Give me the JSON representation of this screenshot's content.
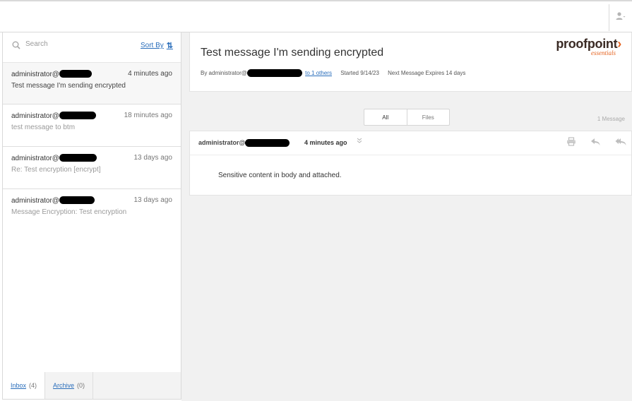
{
  "search": {
    "placeholder": "Search",
    "sort_label": "Sort By",
    "sort_icon": "⇅"
  },
  "messages": [
    {
      "sender": "administrator@",
      "time": "4 minutes ago",
      "subject": "Test message I'm sending encrypted"
    },
    {
      "sender": "administrator@",
      "time": "18 minutes ago",
      "subject": "test message to btm"
    },
    {
      "sender": "administrator@",
      "time": "13 days ago",
      "subject": "Re: Test encryption [encrypt]"
    },
    {
      "sender": "administrator@",
      "time": "13 days ago",
      "subject": "Message Encryption: Test encryption"
    }
  ],
  "tabs": [
    {
      "label": "Inbox",
      "count": "(4)"
    },
    {
      "label": "Archive",
      "count": "(0)"
    }
  ],
  "thread": {
    "title": "Test message I'm sending encrypted",
    "by_label": "By administrator@",
    "recipients_link": "to 1 others",
    "started": "Started 9/14/23",
    "expires": "Next Message Expires 14 days"
  },
  "logo": {
    "main": "proofpoint",
    "mark": "›",
    "sub": "essentials"
  },
  "filter": {
    "all": "All",
    "files": "Files"
  },
  "message_count": "1 Message",
  "message": {
    "from": "administrator@",
    "time": "4 minutes ago",
    "body": "Sensitive content in body and attached."
  },
  "colors": {
    "link": "#2a6ebb",
    "brand_orange": "#e5621e",
    "pane_bg": "#f1f1f1"
  },
  "icons": [
    "search-icon",
    "sort-icon",
    "user-icon",
    "chevron-down-icon",
    "print-icon",
    "reply-icon",
    "reply-all-icon"
  ]
}
